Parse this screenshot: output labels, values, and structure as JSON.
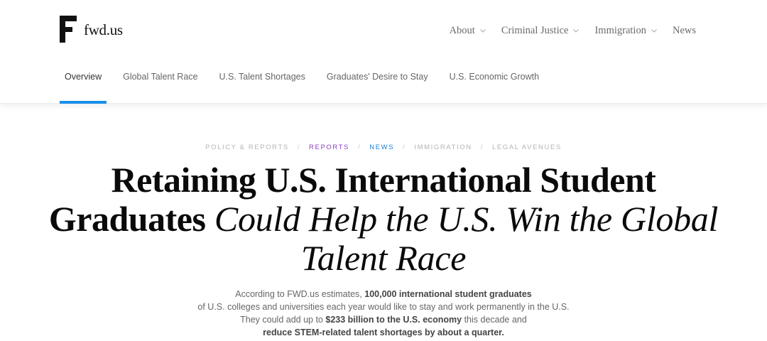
{
  "brand": {
    "name": "fwd.us",
    "logo_icon": "fwd-logo-icon"
  },
  "topnav": [
    {
      "label": "About",
      "has_dropdown": true
    },
    {
      "label": "Criminal Justice",
      "has_dropdown": true
    },
    {
      "label": "Immigration",
      "has_dropdown": true
    },
    {
      "label": "News",
      "has_dropdown": false
    }
  ],
  "subnav": {
    "active_index": 0,
    "accent": "#1a8fe8",
    "items": [
      {
        "label": "Overview"
      },
      {
        "label": "Global Talent Race"
      },
      {
        "label": "U.S. Talent Shortages"
      },
      {
        "label": "Graduates' Desire to Stay"
      },
      {
        "label": "U.S. Economic Growth"
      }
    ]
  },
  "breadcrumbs": [
    {
      "label": "Policy & Reports",
      "color": "#b4b4b4"
    },
    {
      "label": "Reports",
      "color": "#8a3fc0"
    },
    {
      "label": "News",
      "color": "#1a7fd6"
    },
    {
      "label": "Immigration",
      "color": "#b4b4b4"
    },
    {
      "label": "Legal Avenues",
      "color": "#b4b4b4"
    }
  ],
  "breadcrumb_separator": "/",
  "headline": {
    "bold": "Retaining U.S. International Student Graduates",
    "italic": "Could Help the U.S. Win the Global Talent Race"
  },
  "intro": {
    "line1_a": "According to FWD.us estimates, ",
    "line1_b": "100,000 international student graduates",
    "line2": "of U.S. colleges and universities each year would like to stay and work permanently in the U.S.",
    "line3_a": "They could add up to ",
    "line3_b": "$233 billion to the U.S. economy",
    "line3_c": " this decade and",
    "line4": "reduce STEM-related talent shortages by about a quarter."
  }
}
